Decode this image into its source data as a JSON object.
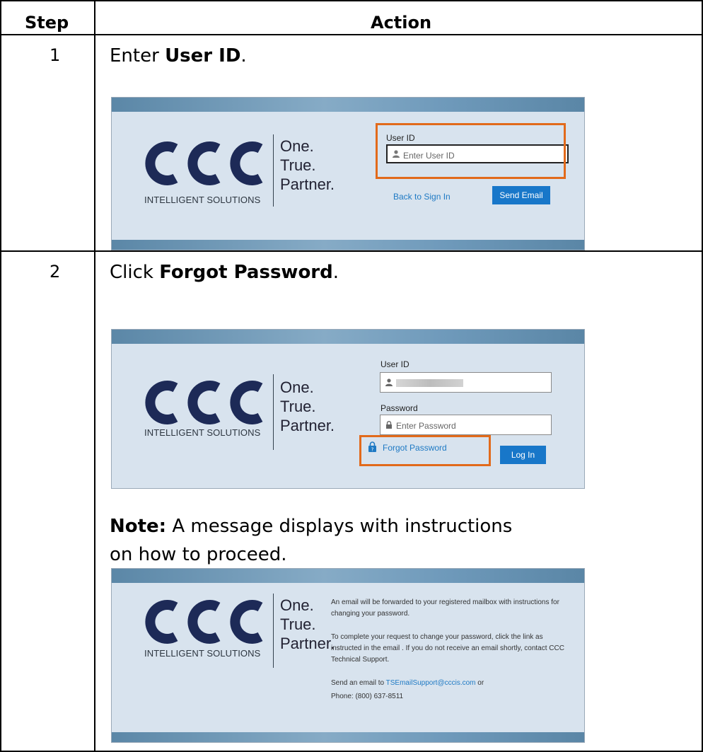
{
  "header": {
    "step": "Step",
    "action": "Action"
  },
  "rows": [
    {
      "step": "1",
      "instr_prefix": "Enter ",
      "instr_bold": "User ID",
      "instr_suffix": ".",
      "screen": {
        "logo_sub": "INTELLIGENT SOLUTIONS",
        "tagline": [
          "One.",
          "True.",
          "Partner."
        ],
        "userid_label": "User ID",
        "userid_placeholder": "Enter User ID",
        "back_link": "Back to Sign In",
        "send_button": "Send Email"
      }
    },
    {
      "step": "2",
      "instr_prefix": "Click ",
      "instr_bold": "Forgot Password",
      "instr_suffix": ".",
      "screen": {
        "logo_sub": "INTELLIGENT SOLUTIONS",
        "tagline": [
          "One.",
          "True.",
          "Partner."
        ],
        "userid_label": "User ID",
        "password_label": "Password",
        "password_placeholder": "Enter Password",
        "forgot_link": "Forgot Password",
        "login_button": "Log In"
      },
      "note_label": "Note:",
      "note_text": " A message displays with instructions on how to proceed.",
      "screen2": {
        "logo_sub": "INTELLIGENT SOLUTIONS",
        "tagline": [
          "One.",
          "True.",
          "Partner."
        ],
        "msg1": "An email will be forwarded to your registered mailbox with instructions for changing your password.",
        "msg2": "To complete your request to change your password, click the link as instructed in the email . If you do not receive an email shortly, contact CCC Technical Support.",
        "msg3_prefix": "Send an email to ",
        "msg3_email": "TSEmailSupport@cccis.com",
        "msg3_suffix": " or",
        "msg4": "Phone: (800) 637-8511"
      }
    }
  ],
  "colors": {
    "highlight": "#e26a1b",
    "button": "#1877c9",
    "link": "#1f7ac4",
    "panel": "#d8e3ee",
    "logo": "#1d2a57"
  },
  "icons": [
    "user-icon",
    "lock-icon",
    "help-lock-icon",
    "ccc-logo"
  ]
}
